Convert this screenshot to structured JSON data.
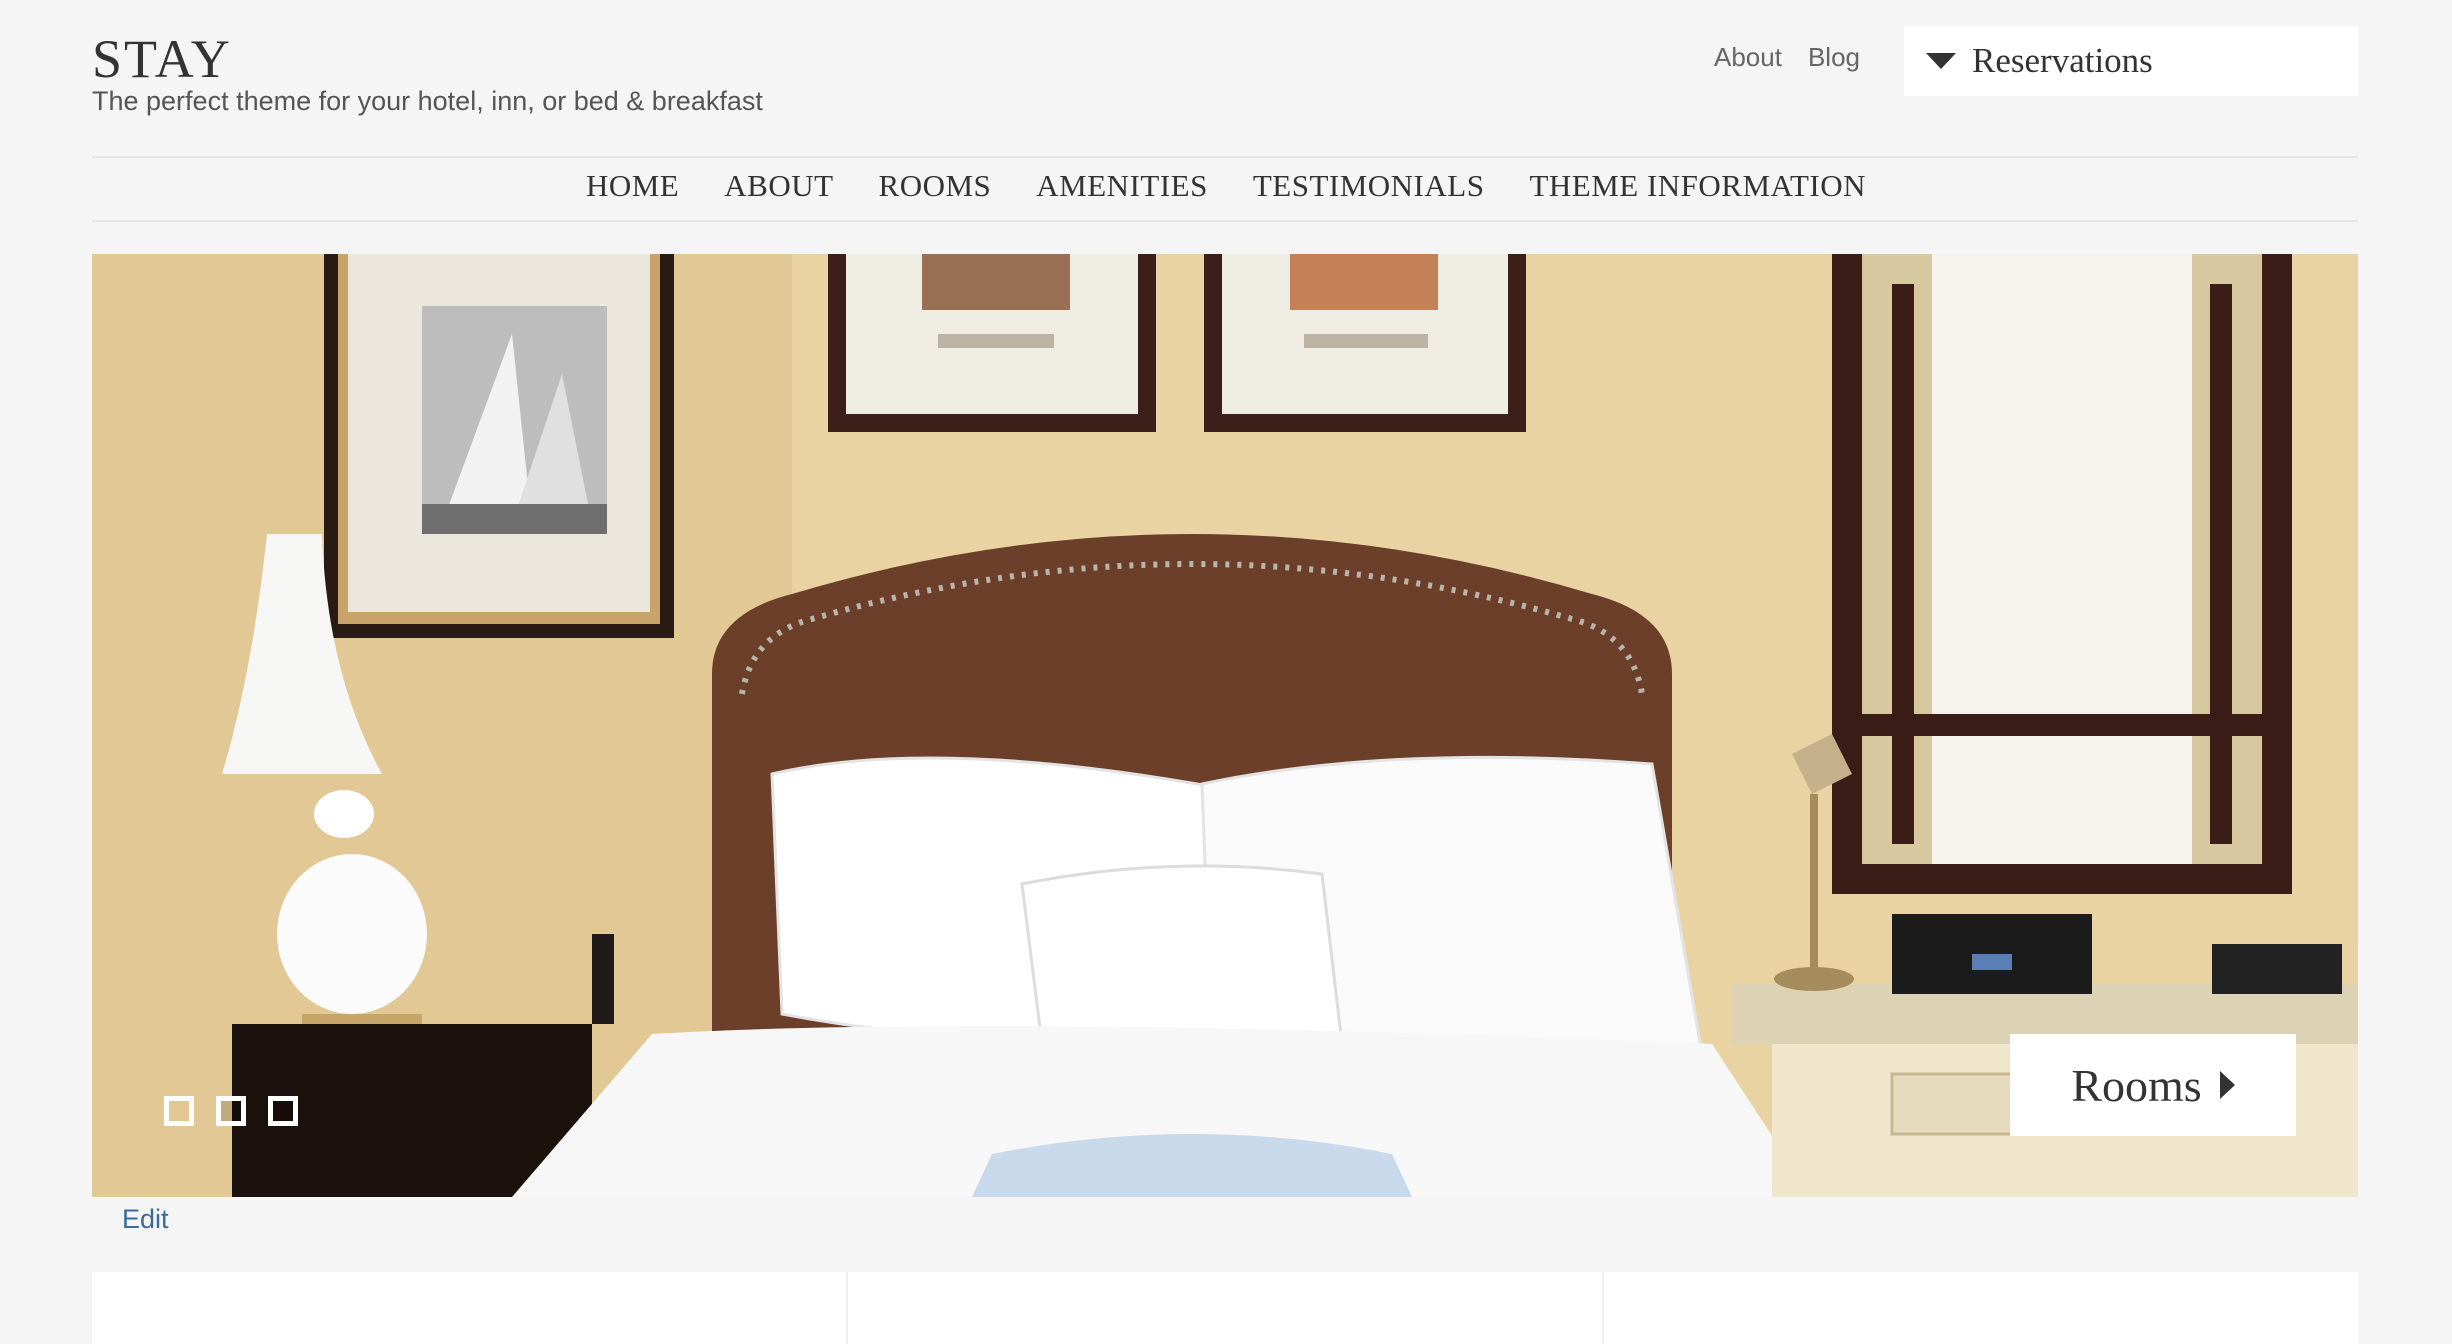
{
  "site": {
    "title": "STAY",
    "tagline": "The perfect theme for your hotel, inn, or bed & breakfast"
  },
  "utility_nav": [
    "About",
    "Blog"
  ],
  "reservations": {
    "label": "Reservations"
  },
  "main_nav": [
    "HOME",
    "ABOUT",
    "ROOMS",
    "AMENITIES",
    "TESTIMONIALS",
    "THEME INFORMATION"
  ],
  "slider": {
    "cta_label": "Rooms",
    "slide_count": 3,
    "active_index": 0
  },
  "edit_link": "Edit",
  "cards": [
    {
      "heading": ""
    },
    {
      "heading": ""
    },
    {
      "heading": ""
    }
  ],
  "colors": {
    "background": "#f5f5f5",
    "link": "#3a6a9a",
    "text": "#333333"
  }
}
